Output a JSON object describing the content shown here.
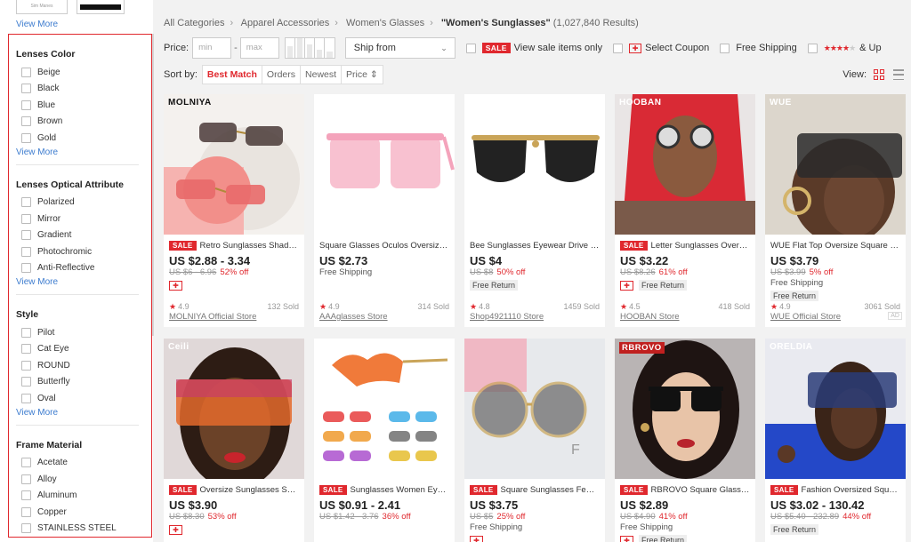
{
  "sidebar": {
    "top_thumbs": [
      "Sim Manes",
      ""
    ],
    "top_view_more": "View More",
    "groups": [
      {
        "title": "Lenses Color",
        "options": [
          "Beige",
          "Black",
          "Blue",
          "Brown",
          "Gold"
        ],
        "more": "View More"
      },
      {
        "title": "Lenses Optical Attribute",
        "options": [
          "Polarized",
          "Mirror",
          "Gradient",
          "Photochromic",
          "Anti-Reflective"
        ],
        "more": "View More"
      },
      {
        "title": "Style",
        "options": [
          "Pilot",
          "Cat Eye",
          "ROUND",
          "Butterfly",
          "Oval"
        ],
        "more": "View More"
      },
      {
        "title": "Frame Material",
        "options": [
          "Acetate",
          "Alloy",
          "Aluminum",
          "Copper",
          "STAINLESS STEEL"
        ],
        "more": ""
      }
    ]
  },
  "breadcrumb": {
    "items": [
      "All Categories",
      "Apparel Accessories",
      "Women's Glasses"
    ],
    "current": "\"Women's Sunglasses\"",
    "count": "(1,027,840 Results)"
  },
  "filters": {
    "price_label": "Price:",
    "min_placeholder": "min",
    "max_placeholder": "max",
    "ship_from": "Ship from",
    "sale_badge": "SALE",
    "sale_items": "View sale items only",
    "coupon": "Select Coupon",
    "free_shipping": "Free Shipping",
    "and_up": "& Up"
  },
  "sort": {
    "label": "Sort by:",
    "tabs": [
      "Best Match",
      "Orders",
      "Newest",
      "Price ⇕"
    ],
    "view_label": "View:"
  },
  "colors": {
    "accent": "#e0282e",
    "link": "#3d7ccf"
  },
  "products": [
    {
      "brand": "MOLNIYA",
      "sale": true,
      "title": "Retro Sunglasses Shades ...",
      "price": "US $2.88 - 3.34",
      "orig": "US $6 - 6.96",
      "off": "52% off",
      "shipping": "",
      "coupon": true,
      "free_return": "",
      "rating": "4.9",
      "sold": "132 Sold",
      "store": "MOLNIYA Official Store",
      "ad": ""
    },
    {
      "brand": "",
      "sale": false,
      "title": "Square Glasses Oculos Oversized ...",
      "price": "US $2.73",
      "orig": "",
      "off": "",
      "shipping": "Free Shipping",
      "coupon": false,
      "free_return": "",
      "rating": "4.9",
      "sold": "314 Sold",
      "store": "AAAglasses Store",
      "ad": ""
    },
    {
      "brand": "",
      "sale": false,
      "title": "Bee Sunglasses Eyewear Drive Fe...",
      "price": "US $4",
      "orig": "US $8",
      "off": "50% off",
      "shipping": "",
      "coupon": false,
      "free_return": "Free Return",
      "rating": "4.8",
      "sold": "1459 Sold",
      "store": "Shop4921110 Store",
      "ad": ""
    },
    {
      "brand": "HOOBAN",
      "sale": true,
      "title": "Letter Sunglasses Oversiz...",
      "price": "US $3.22",
      "orig": "US $8.26",
      "off": "61% off",
      "shipping": "",
      "coupon": true,
      "free_return": "Free Return",
      "rating": "4.5",
      "sold": "418 Sold",
      "store": "HOOBAN Store",
      "ad": ""
    },
    {
      "brand": "WUE",
      "sale": false,
      "title": "WUE Flat Top Oversize Square Sun...",
      "price": "US $3.79",
      "orig": "US $3.99",
      "off": "5% off",
      "shipping": "Free Shipping",
      "coupon": false,
      "free_return": "Free Return",
      "rating": "4.9",
      "sold": "3061 Sold",
      "store": "WUE Official Store",
      "ad": "AD"
    },
    {
      "brand": "Ceili",
      "sale": true,
      "title": "Oversize Sunglasses Squa...",
      "price": "US $3.90",
      "orig": "US $8.30",
      "off": "53% off",
      "shipping": "",
      "coupon": true,
      "free_return": "",
      "rating": "",
      "sold": "",
      "store": "",
      "ad": ""
    },
    {
      "brand": "",
      "sale": true,
      "title": "Sunglasses Women Eyewe...",
      "price": "US $0.91 - 2.41",
      "orig": "US $1.42 - 3.76",
      "off": "36% off",
      "shipping": "",
      "coupon": false,
      "free_return": "",
      "rating": "",
      "sold": "",
      "store": "",
      "ad": ""
    },
    {
      "brand": "",
      "sale": true,
      "title": "Square Sunglasses Femal...",
      "price": "US $3.75",
      "orig": "US $5",
      "off": "25% off",
      "shipping": "Free Shipping",
      "coupon": true,
      "free_return": "",
      "rating": "",
      "sold": "",
      "store": "",
      "ad": ""
    },
    {
      "brand": "RBROVO",
      "sale": true,
      "title": "RBROVO Square Glasses ...",
      "price": "US $2.89",
      "orig": "US $4.90",
      "off": "41% off",
      "shipping": "Free Shipping",
      "coupon": true,
      "free_return": "Free Return",
      "rating": "",
      "sold": "",
      "store": "",
      "ad": ""
    },
    {
      "brand": "ORELDIA",
      "sale": true,
      "title": "Fashion Oversized Square...",
      "price": "US $3.02 - 130.42",
      "orig": "US $5.40 - 232.89",
      "off": "44% off",
      "shipping": "",
      "coupon": false,
      "free_return": "Free Return",
      "rating": "",
      "sold": "",
      "store": "",
      "ad": ""
    }
  ]
}
